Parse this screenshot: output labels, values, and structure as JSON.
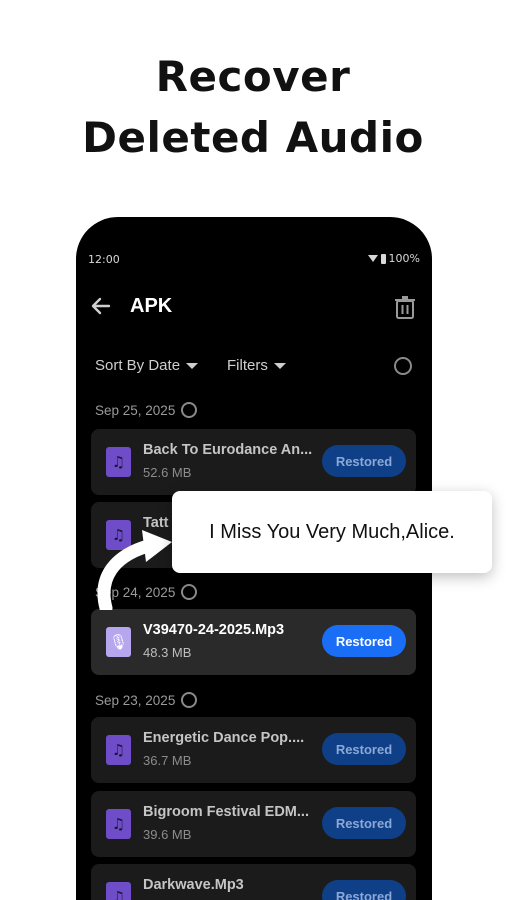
{
  "headline": {
    "line1": "Recover",
    "line2": "Deleted Audio"
  },
  "status_bar": {
    "time": "12:00",
    "battery": "100%"
  },
  "app_bar": {
    "title": "APK"
  },
  "toolbar": {
    "sort_label": "Sort By Date",
    "filters_label": "Filters"
  },
  "groups": [
    {
      "date": "Sep 25, 2025"
    },
    {
      "date": "Sep 24, 2025"
    },
    {
      "date": "Sep 23, 2025"
    }
  ],
  "files": [
    {
      "name": "Back To Eurodance An...",
      "size": "52.6 MB",
      "action": "Restored"
    },
    {
      "name": "Tatt",
      "size": "",
      "action": ""
    },
    {
      "name": "V39470-24-2025.Mp3",
      "size": "48.3 MB",
      "action": "Restored"
    },
    {
      "name": "Energetic Dance Pop....",
      "size": "36.7 MB",
      "action": "Restored"
    },
    {
      "name": "Bigroom Festival EDM...",
      "size": "39.6 MB",
      "action": "Restored"
    },
    {
      "name": "Darkwave.Mp3",
      "size": "",
      "action": "Restored"
    }
  ],
  "callout": {
    "text": "I Miss You Very Much,Alice."
  },
  "icons": {
    "back": "back-arrow-icon",
    "delete": "trash-icon",
    "music": "music-note-icon",
    "voice": "microphone-icon"
  },
  "colors": {
    "accent": "#1a6ef5",
    "background": "#000000",
    "card": "#1b1b1b",
    "file_icon": "#6f4dc9"
  }
}
